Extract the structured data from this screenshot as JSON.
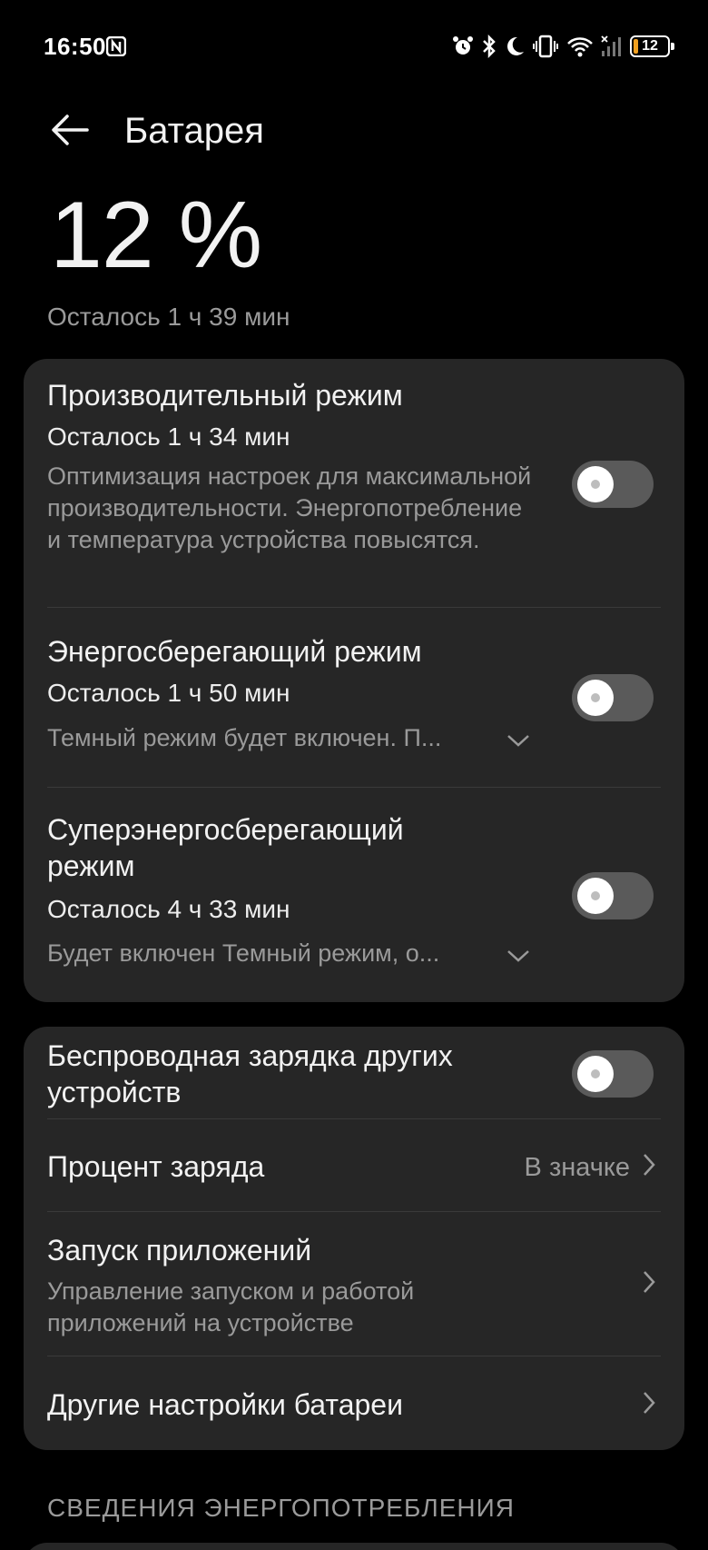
{
  "status_bar": {
    "time": "16:50",
    "battery_level": "12",
    "battery_fraction": 0.12,
    "icons": [
      "nfc-icon",
      "alarm-icon",
      "bluetooth-icon",
      "moon-icon",
      "vibrate-icon",
      "wifi-icon",
      "signal-icon",
      "battery-icon"
    ]
  },
  "header": {
    "title": "Батарея",
    "back_icon": "arrow-left-icon"
  },
  "summary": {
    "percent": "12 %",
    "remaining": "Осталось 1 ч 39 мин"
  },
  "modes": [
    {
      "title": "Производительный режим",
      "remaining": "Осталось 1 ч 34 мин",
      "description": "Оптимизация настроек для максимальной производительности. Энергопотребление и температура устройства повысятся.",
      "enabled": false
    },
    {
      "title": "Энергосберегающий режим",
      "remaining": "Осталось 1 ч 50 мин",
      "description": "Темный режим будет включен. П...",
      "enabled": false
    },
    {
      "title": "Суперэнергосберегающий режим",
      "remaining": "Осталось 4 ч 33 мин",
      "description": "Будет включен Темный режим, о...",
      "enabled": false
    }
  ],
  "settings": {
    "wireless_charging": {
      "title": "Беспроводная зарядка других устройств",
      "enabled": false
    },
    "charge_percent": {
      "title": "Процент заряда",
      "value": "В значке"
    },
    "app_launch": {
      "title": "Запуск приложений",
      "description": "Управление запуском и работой приложений на устройстве"
    },
    "other_settings": {
      "title": "Другие настройки батареи"
    }
  },
  "section_header": "СВЕДЕНИЯ ЭНЕРГОПОТРЕБЛЕНИЯ",
  "colors": {
    "background": "#000000",
    "card": "#262626",
    "text_primary": "#f2f2f2",
    "text_secondary": "#9a9a9a",
    "toggle_off": "#5a5a5a",
    "battery_low": "#f0a020"
  }
}
